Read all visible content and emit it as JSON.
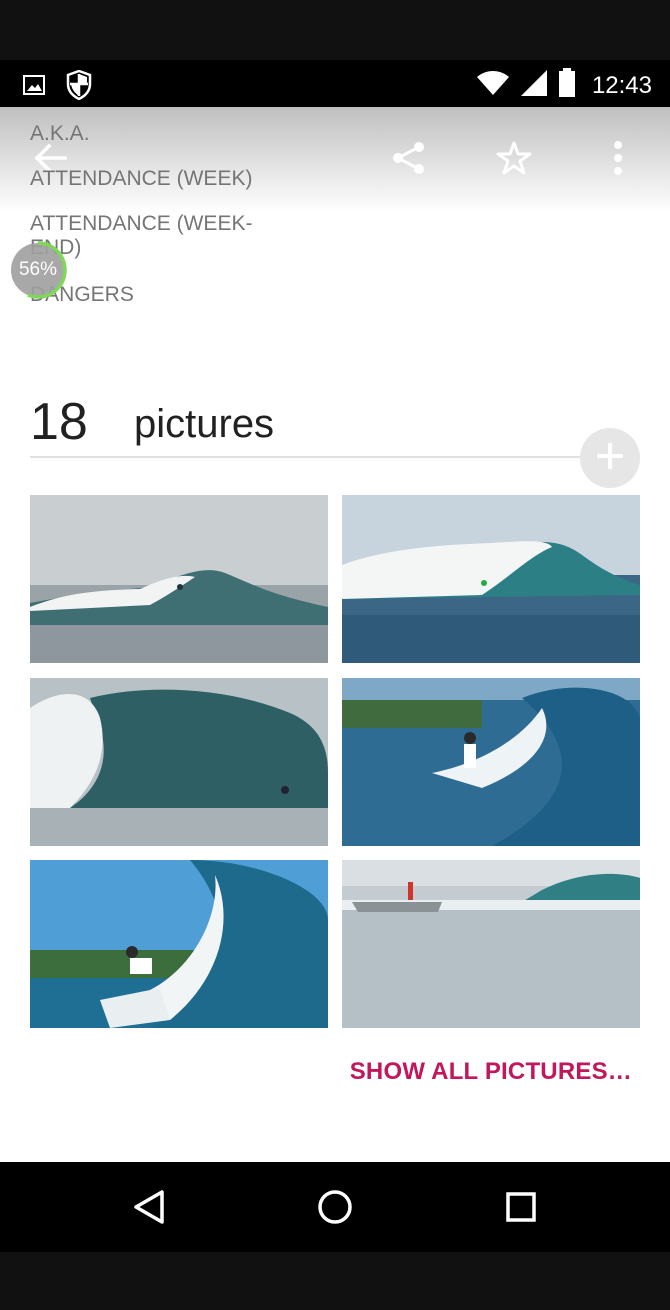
{
  "status_bar": {
    "time": "12:43",
    "icons": [
      "image-icon",
      "shield-icon",
      "wifi-icon",
      "signal-icon",
      "battery-icon"
    ]
  },
  "toolbar": {
    "icons": [
      "back-arrow-icon",
      "share-icon",
      "star-icon",
      "more-vert-icon"
    ]
  },
  "info_fields": [
    "A.K.A.",
    "ATTENDANCE (WEEK)",
    "ATTENDANCE (WEEK-END)",
    "DANGERS"
  ],
  "progress": {
    "label": "56%",
    "value": 0.56
  },
  "pictures": {
    "count": "18",
    "label": "pictures",
    "add_icon": "plus-icon",
    "thumbnails": [
      "surf-photo-1",
      "surf-photo-2",
      "surf-photo-3",
      "surf-photo-4",
      "surf-photo-5",
      "surf-photo-6"
    ],
    "show_all_label": "SHOW ALL PICTURES…"
  },
  "nav_bar": {
    "icons": [
      "back-triangle-icon",
      "home-circle-icon",
      "recents-square-icon"
    ]
  },
  "colors": {
    "accent": "#c2185b",
    "progress": "#7ed957"
  }
}
